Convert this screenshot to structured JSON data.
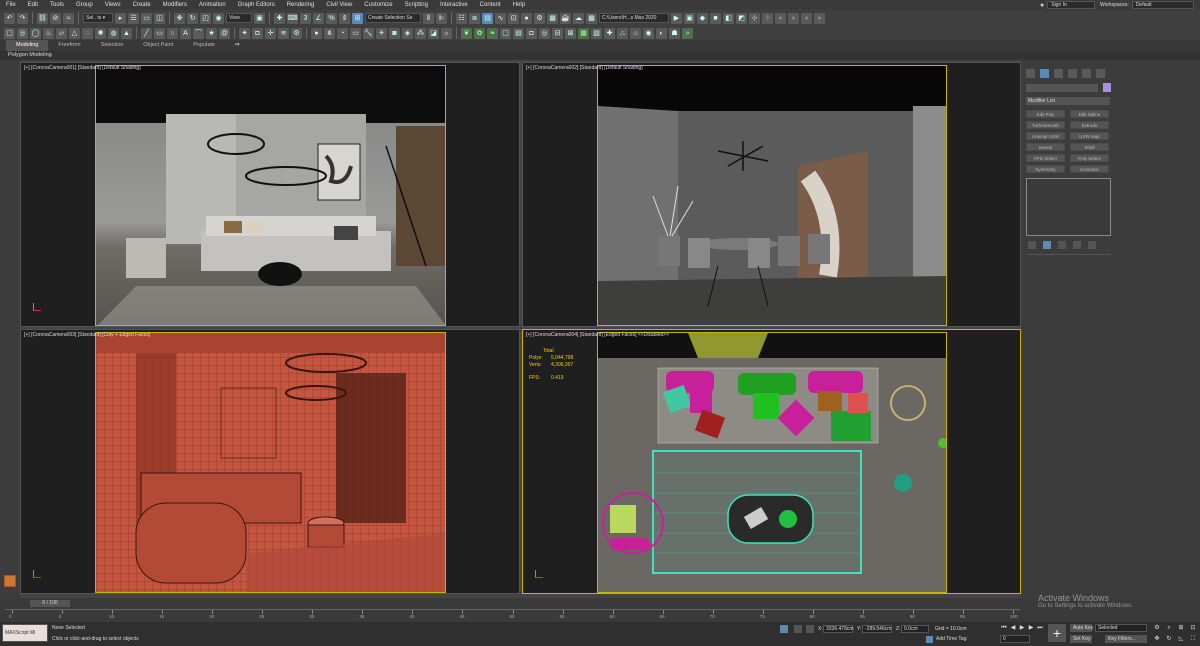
{
  "menu": [
    "File",
    "Edit",
    "Tools",
    "Group",
    "Views",
    "Create",
    "Modifiers",
    "Animation",
    "Graph Editors",
    "Rendering",
    "Civil View",
    "Customize",
    "Scripting",
    "Interactive",
    "Content",
    "Help"
  ],
  "account": {
    "sign_in": "Sign In",
    "workspaces_label": "Workspaces:",
    "workspace_value": "Default"
  },
  "toolbar": {
    "selection_filter": "Sel.. ts ▾",
    "ref_coord": "View",
    "named_selection": "Create Selection Se",
    "project_path": "C:\\Users\\H...s Max 2020"
  },
  "ribbon": {
    "tabs": [
      "Modeling",
      "Freeform",
      "Selection",
      "Object Paint",
      "Populate"
    ],
    "active_tab": "Modeling",
    "sub_label": "Polygon Modeling"
  },
  "viewports": [
    {
      "label": "[+] [CoronaCamera001] [Standard] [Default Shading]"
    },
    {
      "label": "[+] [CoronaCamera002] [Standard] [Default Shading]"
    },
    {
      "label": "[+] [CoronaCamera003] [Standard] [Clay + Edged Faces]"
    },
    {
      "label": "[+] [CoronaCamera004] [Standard] [Edged Faces]  <<Disabled>>"
    }
  ],
  "stats": {
    "title": "Total",
    "polys_label": "Polys:",
    "polys": "5,044,798",
    "verts_label": "Verts:",
    "verts": "4,306,397",
    "fps_label": "FPS:",
    "fps": "0.419"
  },
  "command_panel": {
    "modifier_list": "Modifier List",
    "buttons": [
      "Edit Poly",
      "Edit Spline",
      "TurboSmooth",
      "Extrude",
      "Unwrap UVW",
      "UVW Map",
      "Sweep",
      "Shell",
      "FFD Select",
      "Poly Select",
      "Symmetry",
      "CrossSec"
    ]
  },
  "timeline": {
    "slider": "0 / 100",
    "ticks": [
      "0",
      "5",
      "10",
      "15",
      "20",
      "25",
      "30",
      "35",
      "40",
      "45",
      "50",
      "55",
      "60",
      "65",
      "70",
      "75",
      "80",
      "85",
      "90",
      "95",
      "100"
    ]
  },
  "status": {
    "maxscript": "MAXScript Mi",
    "selection": "None Selected",
    "prompt": "Click or click-and-drag to select objects",
    "x_label": "X:",
    "x_value": "3336.478cm",
    "y_label": "Y:",
    "y_value": "-289.546cm",
    "z_label": "Z:",
    "z_value": "0.0cm",
    "grid": "Grid = 10.0cm",
    "add_time_tag": "Add Time Tag",
    "auto_key": "Auto Key",
    "set_key": "Set Key",
    "key_mode": "Selected",
    "key_filters": "Key Filters...",
    "frame": "0"
  },
  "watermark": {
    "line1": "Activate Windows",
    "line2": "Go to Settings to activate Windows."
  },
  "colors": {
    "active_border": "#c8b400",
    "clay": "#c6553f",
    "stats": "#f5d000"
  }
}
